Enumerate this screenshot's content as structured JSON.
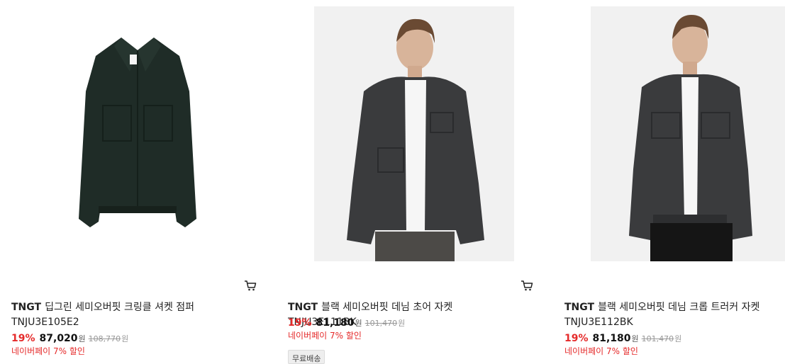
{
  "products": [
    {
      "brand": "TNGT",
      "name": "딥그린 세미오버핏 크링클 셔켓 점퍼 TNJU3E105E2",
      "discount_rate": "19%",
      "sale_price": "87,020",
      "currency": "원",
      "original_price": "108,770",
      "benefit": "네이버페이 7% 할인",
      "image_icon": "green-jacket-image",
      "cart_icon": "cart-icon"
    },
    {
      "brand": "TNGT",
      "name": "블랙 세미오버핏 데님 초어 자켓 TNJU3E111BK",
      "discount_rate": "19%",
      "sale_price": "81,180",
      "currency": "원",
      "original_price": "101,470",
      "benefit": "네이버페이 7% 할인",
      "badge": "무료배송",
      "image_icon": "denim-jacket-model-image",
      "cart_icon": "cart-icon"
    },
    {
      "brand": "TNGT",
      "name": "블랙 세미오버핏 데님 크롭 트러커 자켓 TNJU3E112BK",
      "discount_rate": "19%",
      "sale_price": "81,180",
      "currency": "원",
      "original_price": "101,470",
      "benefit": "네이버페이 7% 할인",
      "image_icon": "denim-trucker-model-image"
    }
  ],
  "colors": {
    "discount_red": "#e52a2a",
    "jacket_green": "#1f2c27",
    "denim_black": "#3a3b3d"
  }
}
